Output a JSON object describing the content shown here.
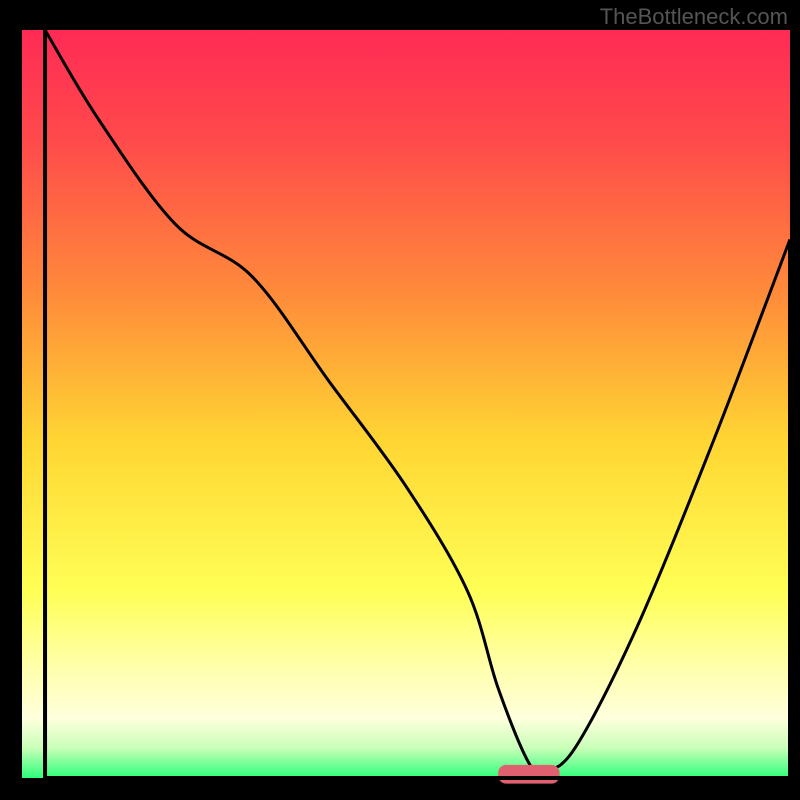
{
  "watermark": "TheBottleneck.com",
  "chart_data": {
    "type": "line",
    "title": "",
    "xlabel": "",
    "ylabel": "",
    "xlim": [
      0,
      100
    ],
    "ylim": [
      0,
      100
    ],
    "gradient_stops": [
      {
        "offset": 0.0,
        "color": "#ff2a55"
      },
      {
        "offset": 0.15,
        "color": "#ff4b4b"
      },
      {
        "offset": 0.35,
        "color": "#ff8a3a"
      },
      {
        "offset": 0.55,
        "color": "#ffd633"
      },
      {
        "offset": 0.75,
        "color": "#ffff55"
      },
      {
        "offset": 0.85,
        "color": "#ffffaa"
      },
      {
        "offset": 0.92,
        "color": "#ffffdd"
      },
      {
        "offset": 0.96,
        "color": "#c8ffb8"
      },
      {
        "offset": 1.0,
        "color": "#2dff7a"
      }
    ],
    "series": [
      {
        "name": "bottleneck-curve",
        "color": "#000000",
        "x": [
          3,
          10,
          20,
          30,
          40,
          50,
          58,
          62,
          66,
          68,
          72,
          80,
          90,
          100
        ],
        "values": [
          100,
          88,
          74,
          67,
          53,
          39,
          25,
          12,
          2,
          1,
          4,
          20,
          45,
          72
        ]
      }
    ],
    "marker": {
      "name": "optimal-range",
      "color": "#e06070",
      "x_start": 62,
      "x_end": 70,
      "y": 0.5,
      "thickness": 2.5
    },
    "axes": {
      "left": {
        "x": 3,
        "y0": 0,
        "y1": 100
      },
      "bottom": {
        "y": 0,
        "x0": 3,
        "x1": 100
      },
      "right": {
        "x": 100,
        "y0": 0,
        "y1": 72
      }
    }
  }
}
